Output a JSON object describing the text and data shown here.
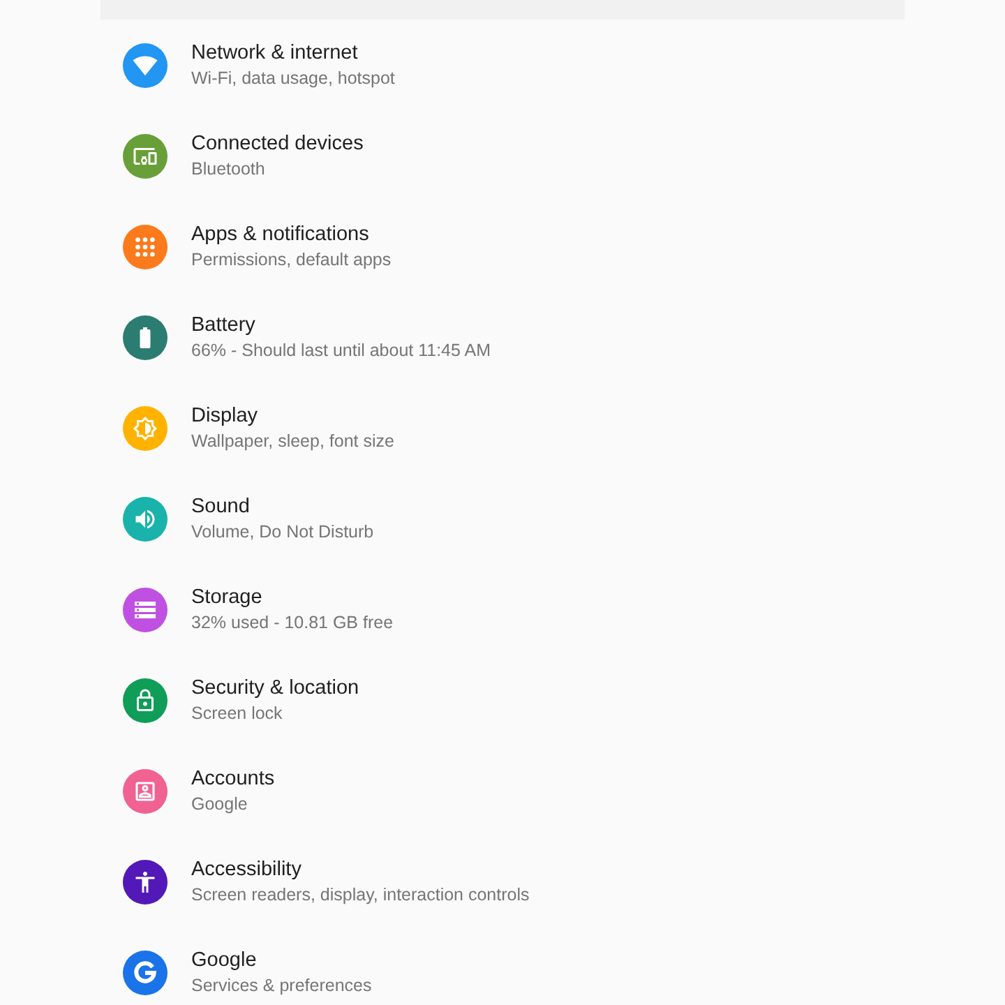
{
  "settings": [
    {
      "title": "Network & internet",
      "summary": "Wi-Fi, data usage, hotspot",
      "color": "#2196f3"
    },
    {
      "title": "Connected devices",
      "summary": "Bluetooth",
      "color": "#689f38"
    },
    {
      "title": "Apps & notifications",
      "summary": "Permissions, default apps",
      "color": "#fb7a1c"
    },
    {
      "title": "Battery",
      "summary": "66% - Should last until about 11:45 AM",
      "color": "#2b7d71"
    },
    {
      "title": "Display",
      "summary": "Wallpaper, sleep, font size",
      "color": "#ffb300"
    },
    {
      "title": "Sound",
      "summary": "Volume, Do Not Disturb",
      "color": "#19b3ab"
    },
    {
      "title": "Storage",
      "summary": "32% used - 10.81 GB free",
      "color": "#c050e2"
    },
    {
      "title": "Security & location",
      "summary": "Screen lock",
      "color": "#0f9d58"
    },
    {
      "title": "Accounts",
      "summary": "Google",
      "color": "#f06292"
    },
    {
      "title": "Accessibility",
      "summary": "Screen readers, display, interaction controls",
      "color": "#5219b8"
    },
    {
      "title": "Google",
      "summary": "Services & preferences",
      "color": "#1a73e8"
    }
  ]
}
